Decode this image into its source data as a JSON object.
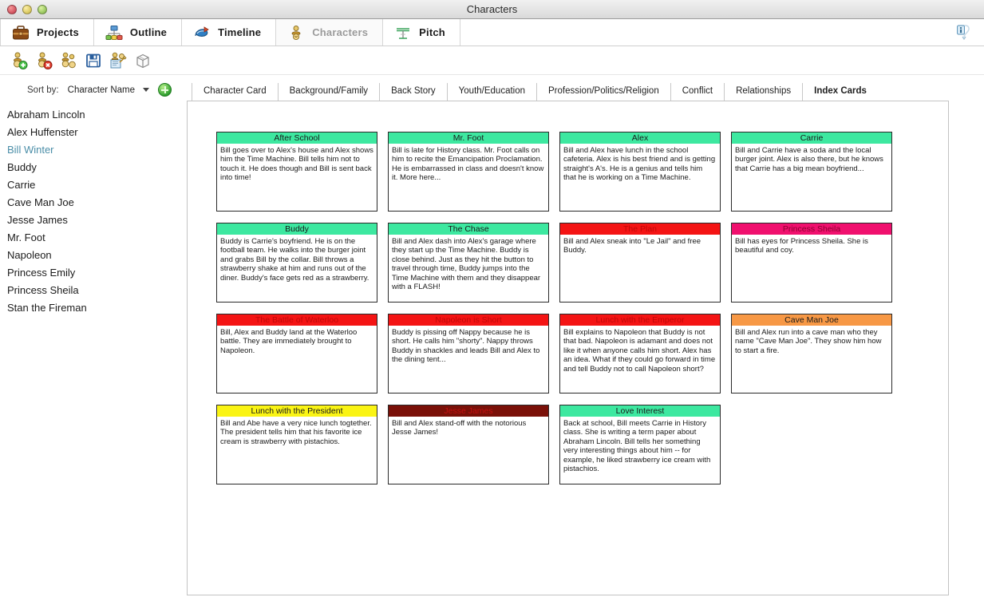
{
  "window": {
    "title": "Characters",
    "controls": [
      "close",
      "minimize",
      "zoom"
    ]
  },
  "modebar": {
    "items": [
      {
        "label": "Projects",
        "icon": "briefcase-icon",
        "active": false
      },
      {
        "label": "Outline",
        "icon": "outline-icon",
        "active": false
      },
      {
        "label": "Timeline",
        "icon": "timeline-icon",
        "active": false
      },
      {
        "label": "Characters",
        "icon": "characters-icon",
        "active": true
      },
      {
        "label": "Pitch",
        "icon": "pitch-icon",
        "active": false
      }
    ],
    "info_icon": "info-icon"
  },
  "toolstrip": {
    "buttons": [
      {
        "name": "add-character-button",
        "icon": "character-add-icon"
      },
      {
        "name": "delete-character-button",
        "icon": "character-delete-icon"
      },
      {
        "name": "duplicate-character-button",
        "icon": "character-duplicate-icon"
      },
      {
        "name": "save-button",
        "icon": "floppy-save-icon"
      },
      {
        "name": "character-report-button",
        "icon": "character-report-icon"
      },
      {
        "name": "archive-box-button",
        "icon": "box-icon"
      }
    ]
  },
  "sidebar": {
    "sort_label": "Sort by:",
    "sort_value": "Character Name",
    "add_button_label": "+",
    "selected": "Bill Winter",
    "characters": [
      "Abraham Lincoln",
      "Alex Huffenster",
      "Bill Winter",
      "Buddy",
      "Carrie",
      "Cave Man Joe",
      "Jesse James",
      "Mr. Foot",
      "Napoleon",
      "Princess Emily",
      "Princess Sheila",
      "Stan the Fireman"
    ]
  },
  "tabs": [
    {
      "label": "Character Card",
      "active": false
    },
    {
      "label": "Background/Family",
      "active": false
    },
    {
      "label": "Back Story",
      "active": false
    },
    {
      "label": "Youth/Education",
      "active": false
    },
    {
      "label": "Profession/Politics/Religion",
      "active": false
    },
    {
      "label": "Conflict",
      "active": false
    },
    {
      "label": "Relationships",
      "active": false
    },
    {
      "label": "Index Cards",
      "active": true
    }
  ],
  "colors": {
    "green": "#3DE8A0",
    "red": "#F41414",
    "magenta": "#F0106E",
    "orange": "#F79845",
    "yellow": "#FAF414",
    "darkred": "#7A1008",
    "header_text_dark": "#1A1A1A",
    "header_text_red": "#C00808",
    "selected_sidebar": "#4B8EA8"
  },
  "cards": [
    {
      "title": "After School",
      "color": "#3DE8A0",
      "title_color": "#1A1A1A",
      "text": "Bill goes over to Alex's house and Alex shows him the Time Machine. Bill tells him not to touch it. He does though and Bill is sent back into time!"
    },
    {
      "title": "Mr. Foot",
      "color": "#3DE8A0",
      "title_color": "#1A1A1A",
      "text": "Bill is late for History class. Mr. Foot calls on him to recite the Emancipation Proclamation. He is embarrassed in class and doesn't know it. More here..."
    },
    {
      "title": "Alex",
      "color": "#3DE8A0",
      "title_color": "#1A1A1A",
      "text": "Bill and Alex have lunch in the school cafeteria. Alex is his best friend and is getting straight's A's. He is a genius and tells him that he is working on a Time Machine."
    },
    {
      "title": "Carrie",
      "color": "#3DE8A0",
      "title_color": "#1A1A1A",
      "text": "Bill and Carrie have a soda and the local burger joint. Alex is also there, but he knows that Carrie has a big mean boyfriend..."
    },
    {
      "title": "Buddy",
      "color": "#3DE8A0",
      "title_color": "#1A1A1A",
      "text": "Buddy is Carrie's boyfriend. He is on the football team. He walks into the burger joint and grabs Bill by the collar. Bill throws a strawberry shake at him and runs out of the diner. Buddy's face gets red as a strawberry."
    },
    {
      "title": "The Chase",
      "color": "#3DE8A0",
      "title_color": "#1A1A1A",
      "text": "Bill and Alex dash into Alex's garage where they start up the Time Machine. Buddy is close behind. Just as they hit the button to travel through time, Buddy jumps into the Time Machine with them and they disappear with a FLASH!"
    },
    {
      "title": "The Plan",
      "color": "#F41414",
      "title_color": "#C00808",
      "text": "Bill and Alex sneak into \"Le Jail\" and free Buddy."
    },
    {
      "title": "Princess Sheila",
      "color": "#F0106E",
      "title_color": "#8C0030",
      "text": "Bill has eyes for Princess Sheila. She is beautiful and coy."
    },
    {
      "title": "The Battle of Waterloo",
      "color": "#F41414",
      "title_color": "#C00808",
      "text": "Bill, Alex and Buddy land at the Waterloo battle. They are immediately brought to Napoleon."
    },
    {
      "title": "Napoleon is Short",
      "color": "#F41414",
      "title_color": "#C00808",
      "text": "Buddy is pissing off Nappy because he is short. He calls him \"shorty\". Nappy throws Buddy in shackles and leads Bill and Alex to the dining tent..."
    },
    {
      "title": "Lunch with the Emperor",
      "color": "#F41414",
      "title_color": "#C00808",
      "text": "Bill explains to Napoleon that Buddy is not that bad. Napoleon is adamant and does not like it when anyone calls him short. Alex has an idea. What if they could go forward in time and tell Buddy not to call Napoleon short?"
    },
    {
      "title": "Cave Man Joe",
      "color": "#F79845",
      "title_color": "#1A1A1A",
      "text": "Bill and Alex run into a cave man who they name \"Cave Man Joe\". They show him how to start a fire."
    },
    {
      "title": "Lunch with the President",
      "color": "#FAF414",
      "title_color": "#1A1A1A",
      "text": "Bill and Abe have a very nice lunch togtether. The president tells him that his favorite ice cream is strawberry with pistachios."
    },
    {
      "title": "Jesse James",
      "color": "#7A1008",
      "title_color": "#C41010",
      "text": "Bill and Alex stand-off with the notorious Jesse James!"
    },
    {
      "title": "Love Interest",
      "color": "#3DE8A0",
      "title_color": "#1A1A1A",
      "text": "Back at school, Bill meets Carrie in History class. She is writing a term paper about Abraham Lincoln. Bill tells her something very interesting things about him -- for example, he liked strawberry ice cream with pistachios."
    }
  ]
}
